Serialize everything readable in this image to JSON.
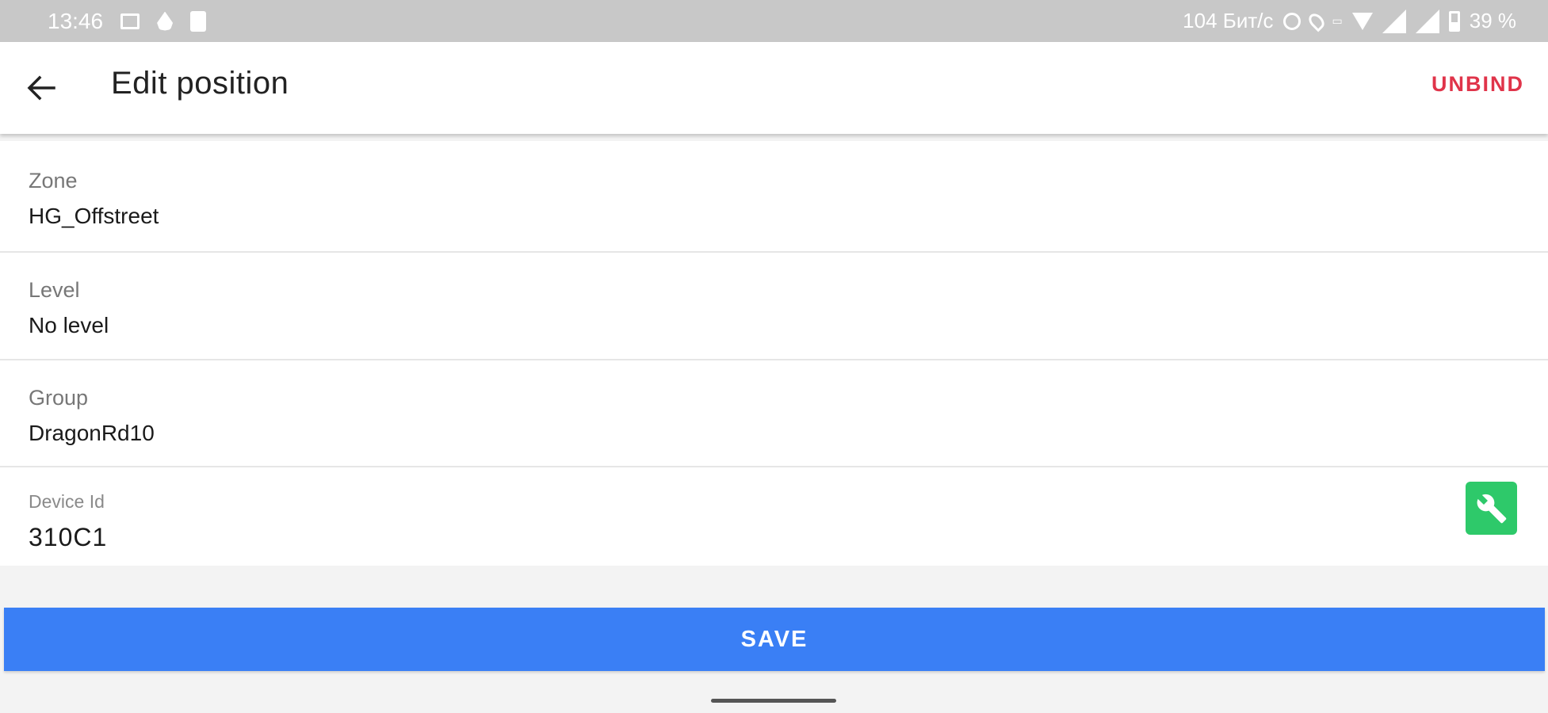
{
  "status_bar": {
    "time": "13:46",
    "speed": "104 Бит/с",
    "battery": "39 %",
    "left_icons": [
      "image-icon",
      "drop-icon",
      "sim-card-icon"
    ],
    "right_icons": [
      "alarm-icon",
      "location-icon",
      "volte-icon",
      "wifi-icon",
      "signal-icon",
      "signal-icon",
      "battery-icon"
    ]
  },
  "app_bar": {
    "title": "Edit position",
    "unbind_label": "UNBIND",
    "unbind_color": "#e0344a",
    "back_icon": "arrow-left-icon"
  },
  "form": {
    "zone": {
      "label": "Zone",
      "value": "HG_Offstreet"
    },
    "level": {
      "label": "Level",
      "value": "No level"
    },
    "group": {
      "label": "Group",
      "value": "DragonRd10"
    },
    "device": {
      "label": "Device Id",
      "value": "310C1",
      "action_icon": "wrench-icon",
      "action_color": "#2ec96a"
    }
  },
  "save_label": "SAVE",
  "save_color": "#3a7ff5"
}
